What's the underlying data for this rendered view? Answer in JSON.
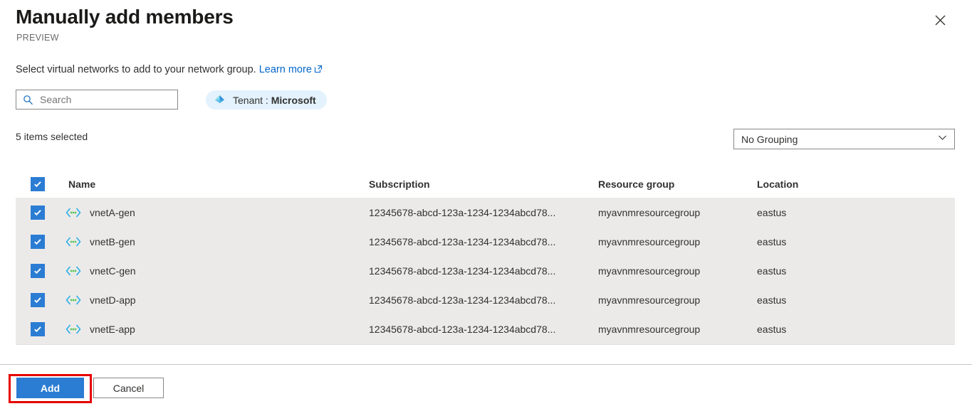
{
  "header": {
    "title": "Manually add members",
    "preview_tag": "PREVIEW",
    "close_icon": "close-icon"
  },
  "description": {
    "text": "Select virtual networks to add to your network group.",
    "link_label": "Learn more",
    "link_icon": "external-link-icon"
  },
  "toolbar": {
    "search": {
      "placeholder": "Search",
      "value": "",
      "icon": "search-icon"
    },
    "tenant_pill": {
      "prefix": "Tenant : ",
      "value": "Microsoft",
      "icon": "azure-tenant-diamond-icon"
    }
  },
  "summary": {
    "items_selected": "5 items selected"
  },
  "grouping": {
    "selected": "No Grouping",
    "chevron_icon": "chevron-down-icon"
  },
  "table": {
    "columns": [
      "Name",
      "Subscription",
      "Resource group",
      "Location"
    ],
    "select_all_checked": true,
    "row_icon": "virtual-network-icon",
    "rows": [
      {
        "checked": true,
        "name": "vnetA-gen",
        "subscription": "12345678-abcd-123a-1234-1234abcd78...",
        "resource_group": "myavnmresourcegroup",
        "location": "eastus"
      },
      {
        "checked": true,
        "name": "vnetB-gen",
        "subscription": "12345678-abcd-123a-1234-1234abcd78...",
        "resource_group": "myavnmresourcegroup",
        "location": "eastus"
      },
      {
        "checked": true,
        "name": "vnetC-gen",
        "subscription": "12345678-abcd-123a-1234-1234abcd78...",
        "resource_group": "myavnmresourcegroup",
        "location": "eastus"
      },
      {
        "checked": true,
        "name": "vnetD-app",
        "subscription": "12345678-abcd-123a-1234-1234abcd78...",
        "resource_group": "myavnmresourcegroup",
        "location": "eastus"
      },
      {
        "checked": true,
        "name": "vnetE-app",
        "subscription": "12345678-abcd-123a-1234-1234abcd78...",
        "resource_group": "myavnmresourcegroup",
        "location": "eastus"
      }
    ]
  },
  "footer": {
    "add_label": "Add",
    "cancel_label": "Cancel"
  },
  "colors": {
    "primary_blue": "#2b7cd3",
    "link_blue": "#0066cc",
    "row_selected_bg": "#ebeae9",
    "tenant_pill_bg": "#e3f2fd",
    "annotation_red": "#e60000"
  }
}
